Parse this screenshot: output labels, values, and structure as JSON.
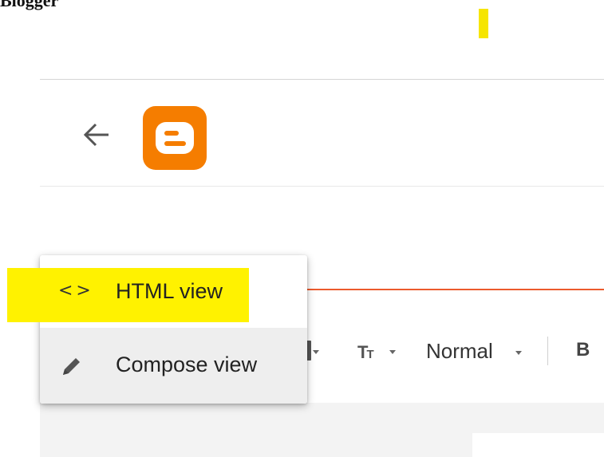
{
  "page": {
    "title": "Blogger"
  },
  "header": {
    "back_icon": "arrow-left-icon",
    "logo_icon": "blogger-logo-icon",
    "logo_color": "#f57d00"
  },
  "view_menu": {
    "items": [
      {
        "label": "HTML view",
        "icon": "code-icon",
        "icon_glyph": "<>",
        "highlighted": true
      },
      {
        "label": "Compose view",
        "icon": "pencil-icon",
        "hovered": true
      }
    ]
  },
  "toolbar": {
    "text_size_icon": "text-size-icon",
    "paragraph_style": "Normal",
    "bold_label": "B"
  },
  "colors": {
    "accent_line": "#ec5a2d",
    "annotation_highlight": "#fff200"
  }
}
